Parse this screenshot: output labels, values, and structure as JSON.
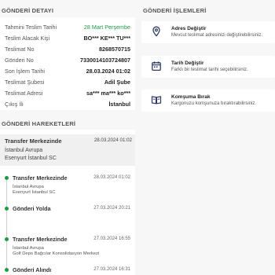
{
  "details": {
    "title": "GÖNDERİ DETAYI",
    "rows": [
      {
        "label": "Tahmini Teslim Tarihi",
        "value": "28 Mart Perşembe"
      },
      {
        "label": "Teslim Alacak Kişi",
        "value": "BO*** KE*** TU***"
      },
      {
        "label": "Teslimat No",
        "value": "8268570715"
      },
      {
        "label": "Gönderi No",
        "value": "7330014103724807"
      },
      {
        "label": "Son İşlem Tarihi",
        "value": "28.03.2024 01:02"
      },
      {
        "label": "Teslimat Şubesi",
        "value": "Adil Şube"
      },
      {
        "label": "Teslimat Adresi",
        "value": "sa*** ma*** ko***"
      },
      {
        "label": "Çıkış İli",
        "value": "İstanbul"
      }
    ],
    "highlight_color": "#1c9b45"
  },
  "actions": {
    "title": "GÖNDERİ İŞLEMLERİ",
    "items": [
      {
        "title": "Adres Değiştir",
        "desc": "Mevcut teslimat adresinizi değiştirebilirsiniz.",
        "icon": "location-pin-icon"
      },
      {
        "title": "Tarih Değiştir",
        "desc": "Farklı bir teslimat tarihi seçebilirsiniz.",
        "icon": "calendar-icon"
      },
      {
        "title": "Komşuma Bırak",
        "desc": "Kargonuzu komşunuza bıraktırabilirsiniz.",
        "icon": "book-icon"
      }
    ]
  },
  "movements": {
    "title": "GÖNDERİ HAREKETLERİ",
    "first": {
      "name": "Transfer Merkezinde",
      "time": "28.03.2024 01:02",
      "line1": "İstanbul Avrupa",
      "line2": "Esenyurt İstanbul SC"
    },
    "items": [
      {
        "name": "Transfer Merkezinde",
        "time": "28.03.2024 01:02",
        "line1": "İstanbul Avrupa",
        "line2": "Esenyurt İstanbul SC"
      },
      {
        "name": "Gönderi Yolda",
        "time": "27.03.2024 20:21",
        "line1": "",
        "line2": ""
      },
      {
        "name": "Transfer Merkezinde",
        "time": "27.03.2024 16:55",
        "line1": "İstanbul Avrupa",
        "line2": "Golf Depo Bağcılar Konsolidasyon Merkezi"
      },
      {
        "name": "Gönderi Alındı",
        "time": "27.03.2024 16:31",
        "line1": "",
        "line2": ""
      }
    ]
  }
}
